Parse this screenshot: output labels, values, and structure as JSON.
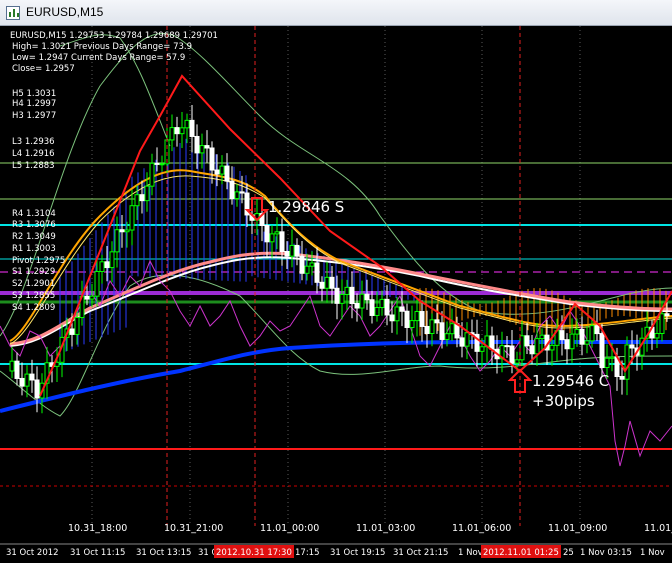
{
  "window": {
    "title": "EURUSD,M15"
  },
  "info": {
    "lines": [
      "EURUSD,M15  1.29753 1.29784 1.29689 1.29701",
      "High= 1.3021    Previous Days Range= 73.9",
      "Low= 1.2947     Current Days Range= 57.9",
      "Close= 1.2957"
    ]
  },
  "levels": [
    {
      "label": "H5 1.3031",
      "color": "#ffffff"
    },
    {
      "label": "H4 1.2997",
      "color": "#ffffff"
    },
    {
      "label": "H3 1.2977",
      "color": "#ffffff"
    },
    {
      "label": "L3 1.2936",
      "color": "#ffffff"
    },
    {
      "label": "L4 1.2916",
      "color": "#ffffff"
    },
    {
      "label": "L5 1.2883",
      "color": "#ffffff"
    },
    {
      "label": "R4 1.3104",
      "color": "#ffffff"
    },
    {
      "label": "R3 1.3076",
      "color": "#ffffff"
    },
    {
      "label": "R2 1.3049",
      "color": "#ffffff"
    },
    {
      "label": "R1 1.3003",
      "color": "#ffffff"
    },
    {
      "label": "Pivot 1.2975",
      "color": "#ffffff"
    },
    {
      "label": "S1 1.2929",
      "color": "#ffffff"
    },
    {
      "label": "S2 1.2901",
      "color": "#ffffff"
    },
    {
      "label": "S3 1.2855",
      "color": "#ffffff"
    },
    {
      "label": "S4 1.2809",
      "color": "#ffffff"
    }
  ],
  "annotations": {
    "sell": "1.29846 S",
    "close_price": "1.29546 C",
    "pips": "+30pips"
  },
  "time_axis": {
    "labels": [
      "10.31_18:00",
      "10.31_21:00",
      "11.01_00:00",
      "11.01_03:00",
      "11.01_06:00",
      "11.01_09:00",
      "11.01_"
    ]
  },
  "date_axis": {
    "labels": [
      "31 Oct 2012",
      "31 Oct 11:15",
      "31 Oct 13:15",
      "31 Oc",
      "17:15",
      "31 Oct 19:15",
      "31 Oct 21:15",
      "1 Nov",
      "25",
      "1 Nov 03:15",
      "1 Nov"
    ],
    "highlights": [
      "2012.10.31 17:30",
      "2012.11.01 01:25"
    ]
  },
  "colors": {
    "bull": "#00ff00",
    "bear": "#ffffff",
    "trendline": "#ff0000",
    "pivot": "#00ffff",
    "support": "#00cc00",
    "ma_blue": "#0033ff",
    "bands": "#7cc27c"
  }
}
